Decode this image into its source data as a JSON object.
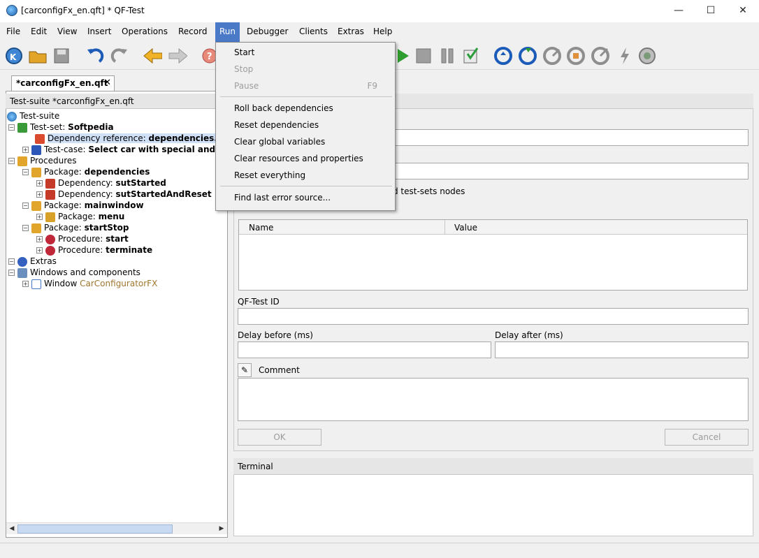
{
  "window": {
    "title": "[carconfigFx_en.qft] * QF-Test",
    "minimize": "—",
    "maximize": "☐",
    "close": "✕"
  },
  "menubar": [
    "File",
    "Edit",
    "View",
    "Insert",
    "Operations",
    "Record",
    "Run",
    "Debugger",
    "Clients",
    "Extras",
    "Help"
  ],
  "run_menu": {
    "items": [
      {
        "label": "Start",
        "enabled": true
      },
      {
        "label": "Stop",
        "enabled": false
      },
      {
        "label": "Pause",
        "enabled": false,
        "shortcut": "F9"
      },
      {
        "label": "Roll back dependencies",
        "enabled": true
      },
      {
        "label": "Reset dependencies",
        "enabled": true
      },
      {
        "label": "Clear global variables",
        "enabled": true
      },
      {
        "label": "Clear resources and properties",
        "enabled": true
      },
      {
        "label": "Reset everything",
        "enabled": true
      },
      {
        "label": "Find last error source...",
        "enabled": true
      }
    ]
  },
  "tab": {
    "label": "*carconfigFx_en.qft",
    "close": "✕"
  },
  "tree": {
    "header": "Test-suite *carconfigFx_en.qft",
    "rows": [
      {
        "prefix": "Test-suite",
        "name": ""
      },
      {
        "prefix": "Test-set: ",
        "name": "Softpedia"
      },
      {
        "prefix": "Dependency reference: ",
        "name": "dependencies.su"
      },
      {
        "prefix": "Test-case: ",
        "name": "Select car with special and ad"
      },
      {
        "prefix": "Procedures",
        "name": ""
      },
      {
        "prefix": "Package: ",
        "name": "dependencies"
      },
      {
        "prefix": "Dependency: ",
        "name": "sutStarted"
      },
      {
        "prefix": "Dependency: ",
        "name": "sutStartedAndReset"
      },
      {
        "prefix": "Package: ",
        "name": "mainwindow"
      },
      {
        "prefix": "Package: ",
        "name": "menu"
      },
      {
        "prefix": "Package: ",
        "name": "startStop"
      },
      {
        "prefix": "Procedure: ",
        "name": "start"
      },
      {
        "prefix": "Procedure: ",
        "name": "terminate"
      },
      {
        "prefix": "Extras",
        "name": ""
      },
      {
        "prefix": "Windows and components",
        "name": ""
      },
      {
        "prefix": "Window ",
        "name": "CarConfiguratorFX"
      }
    ]
  },
  "detail": {
    "checkbox_tail": "d test-sets nodes",
    "var_columns": [
      "Name",
      "Value"
    ],
    "qftest_id_label": "QF-Test ID",
    "delay_before_label": "Delay before (ms)",
    "delay_after_label": "Delay after (ms)",
    "comment_label": "Comment",
    "ok_label": "OK",
    "cancel_label": "Cancel"
  },
  "terminal": {
    "label": "Terminal"
  },
  "colors": {
    "accent": "#4a79c7",
    "selection": "#cfe0f7",
    "window_name": "#a0762c"
  }
}
